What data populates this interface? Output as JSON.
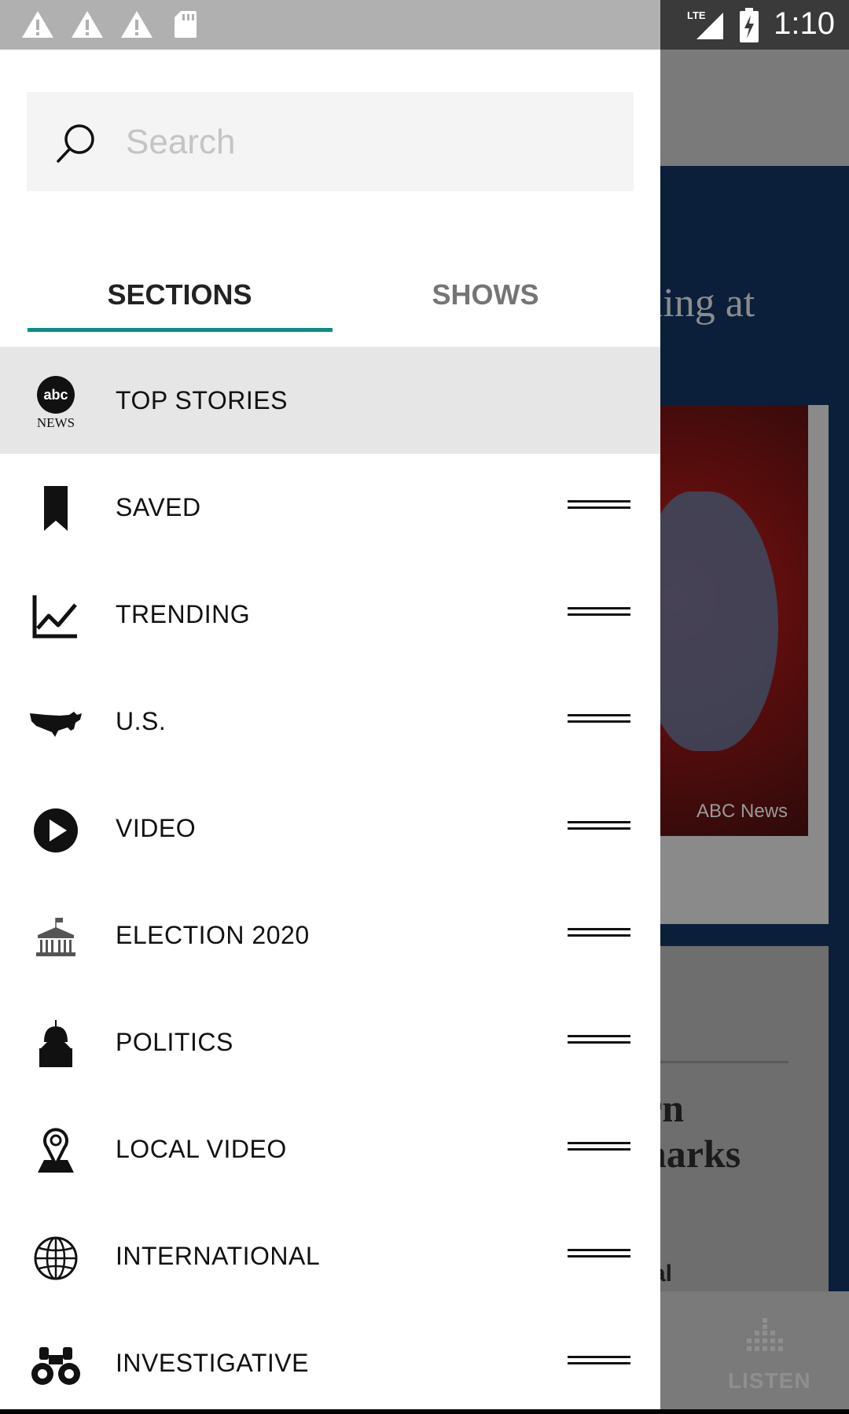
{
  "status_bar": {
    "time": "1:10",
    "left_icons": [
      "warning-icon",
      "warning-icon",
      "warning-icon",
      "sd-card-icon"
    ],
    "network": "LTE"
  },
  "drawer": {
    "search": {
      "placeholder": "Search",
      "value": ""
    },
    "tabs": [
      {
        "label": "SECTIONS",
        "selected": true
      },
      {
        "label": "SHOWS",
        "selected": false
      }
    ],
    "accent_color": "#0a8f84",
    "items": [
      {
        "label": "TOP STORIES",
        "icon": "abc-news-logo-icon",
        "active": true,
        "draggable": false
      },
      {
        "label": "SAVED",
        "icon": "bookmark-icon",
        "active": false,
        "draggable": true
      },
      {
        "label": "TRENDING",
        "icon": "trending-chart-icon",
        "active": false,
        "draggable": true
      },
      {
        "label": "U.S.",
        "icon": "us-map-icon",
        "active": false,
        "draggable": true
      },
      {
        "label": "VIDEO",
        "icon": "play-circle-icon",
        "active": false,
        "draggable": true
      },
      {
        "label": "ELECTION 2020",
        "icon": "government-building-icon",
        "active": false,
        "draggable": true
      },
      {
        "label": "POLITICS",
        "icon": "capitol-dome-icon",
        "active": false,
        "draggable": true
      },
      {
        "label": "LOCAL VIDEO",
        "icon": "map-pin-icon",
        "active": false,
        "draggable": true
      },
      {
        "label": "INTERNATIONAL",
        "icon": "globe-icon",
        "active": false,
        "draggable": true
      },
      {
        "label": "INVESTIGATIVE",
        "icon": "binoculars-icon",
        "active": false,
        "draggable": true
      }
    ]
  },
  "logo_text": {
    "abc": "abc",
    "news": "NEWS"
  },
  "background": {
    "headline_fragment": "illing at",
    "image_credit": "ABC News",
    "card_text_line1": "rn",
    "card_text_line2": "narks",
    "card_small_text": "al",
    "bottom_nav_label": "LISTEN"
  }
}
